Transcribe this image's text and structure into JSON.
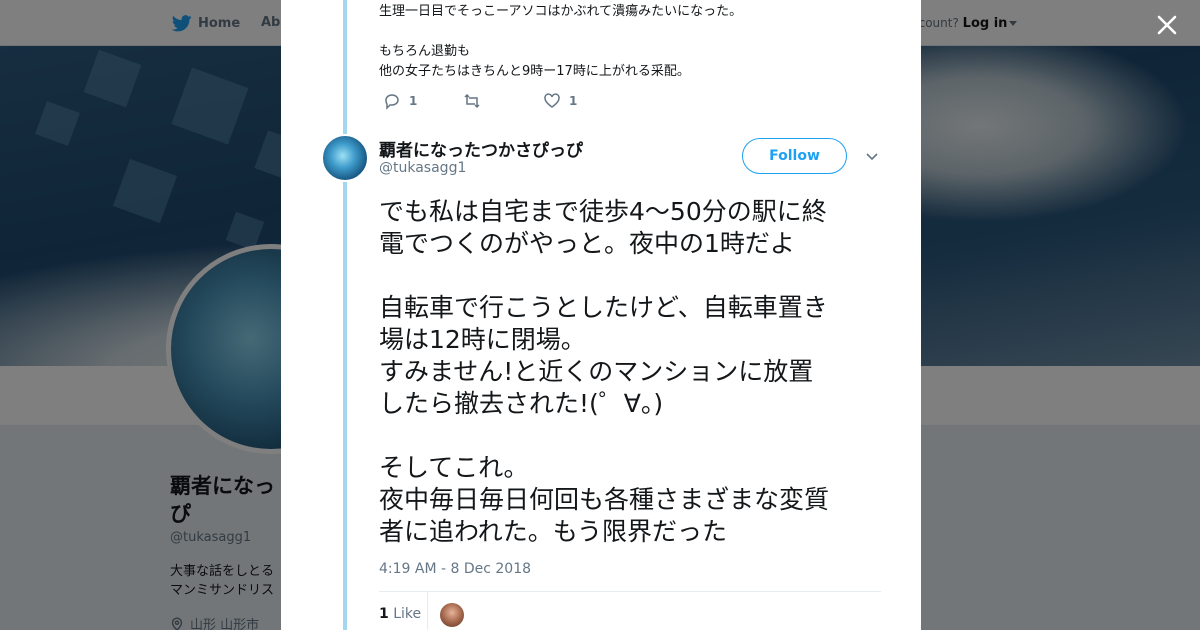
{
  "nav": {
    "home_label": "Home",
    "about_label": "Abo",
    "account_prompt": "ccount?",
    "login_label": "Log in"
  },
  "profile": {
    "name": "覇者になっ\nぴ",
    "handle": "@tukasagg1",
    "bio": "大事な話をしとる\nマンミサンドリス",
    "location": "山形 山形市"
  },
  "prev_tweet": {
    "lines": [
      "生理一日目でそっこーアソコはかぶれて潰瘍みたいになった。",
      "",
      "もちろん退勤も",
      "他の女子たちはきちんと9時ー17時に上がれる采配。"
    ],
    "reply_count": "1",
    "retweet_count": "",
    "like_count": "1"
  },
  "tweet": {
    "display_name": "覇者になったつかさぴっぴ",
    "handle": "@tukasagg1",
    "follow_label": "Follow",
    "body_lines": [
      "でも私は自宅まで徒歩4～50分の駅に終",
      "電でつくのがやっと。夜中の1時だよ",
      "",
      "自転車で行こうとしたけど、自転車置き",
      "場は12時に閉場。",
      "すみません!と近くのマンションに放置",
      "したら撤去された!(゜∀。)",
      "",
      "そしてこれ。",
      "夜中毎日毎日何回も各種さまざまな変質",
      "者に追われた。もう限界だった"
    ],
    "timestamp": "4:19 AM - 8 Dec 2018",
    "like_count": "1",
    "like_label": "Like"
  },
  "icons": {
    "brand": "twitter-bird-icon",
    "close": "close-icon",
    "reply": "reply-icon",
    "retweet": "retweet-icon",
    "like": "heart-icon",
    "chevron": "chevron-down-icon",
    "location": "location-pin-icon"
  },
  "colors": {
    "brand": "#1da1f2",
    "thread_line": "#a3d7f0",
    "text_primary": "#14171a",
    "text_secondary": "#657786"
  }
}
